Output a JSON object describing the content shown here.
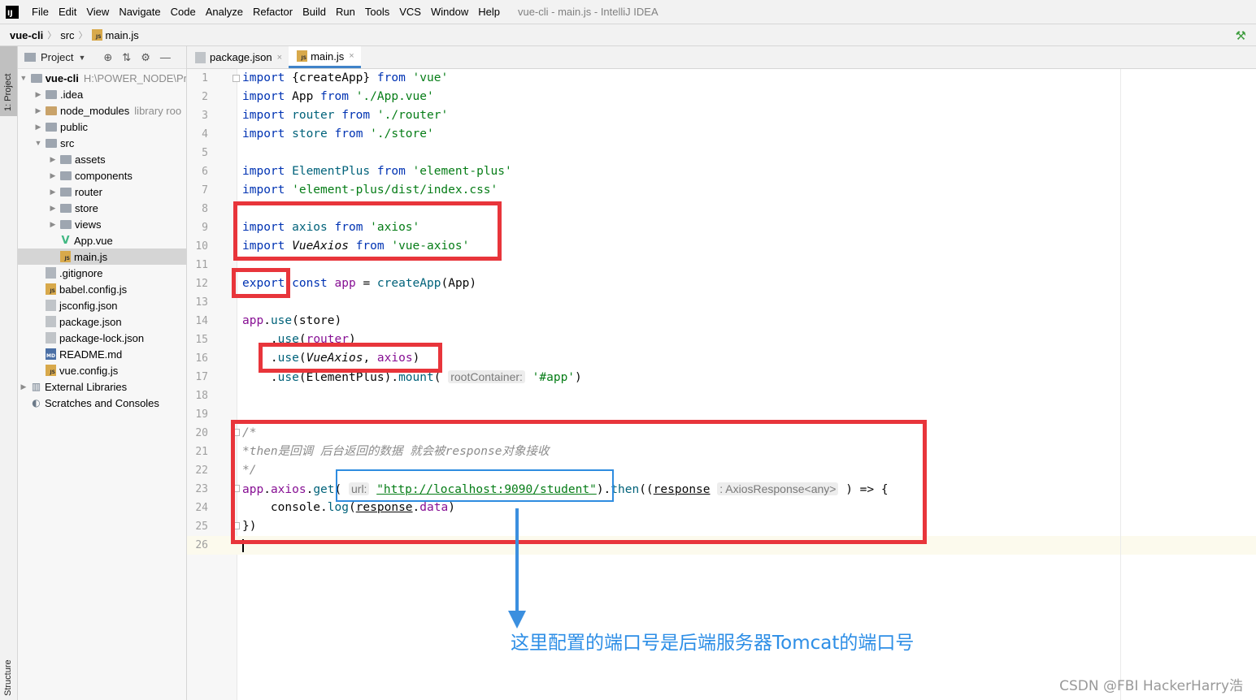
{
  "menubar": {
    "logo": "IJ",
    "items": [
      "File",
      "Edit",
      "View",
      "Navigate",
      "Code",
      "Analyze",
      "Refactor",
      "Build",
      "Run",
      "Tools",
      "VCS",
      "Window",
      "Help"
    ],
    "window_title": "vue-cli - main.js - IntelliJ IDEA"
  },
  "breadcrumb": {
    "project": "vue-cli",
    "folder": "src",
    "file": "main.js"
  },
  "tool_stripe": {
    "project_tab": "1: Project",
    "structure_tab": "Structure"
  },
  "project_panel": {
    "title": "Project",
    "tree": [
      {
        "label": "vue-cli",
        "extra": "H:\\POWER_NODE\\Pr",
        "depth": 0,
        "arrow": "▼",
        "icon": "folder",
        "bold": true
      },
      {
        "label": ".idea",
        "depth": 1,
        "arrow": "▶",
        "icon": "folder"
      },
      {
        "label": "node_modules",
        "extra": "library roo",
        "depth": 1,
        "arrow": "▶",
        "icon": "folder-orange"
      },
      {
        "label": "public",
        "depth": 1,
        "arrow": "▶",
        "icon": "folder"
      },
      {
        "label": "src",
        "depth": 1,
        "arrow": "▼",
        "icon": "folder"
      },
      {
        "label": "assets",
        "depth": 2,
        "arrow": "▶",
        "icon": "folder"
      },
      {
        "label": "components",
        "depth": 2,
        "arrow": "▶",
        "icon": "folder"
      },
      {
        "label": "router",
        "depth": 2,
        "arrow": "▶",
        "icon": "folder"
      },
      {
        "label": "store",
        "depth": 2,
        "arrow": "▶",
        "icon": "folder"
      },
      {
        "label": "views",
        "depth": 2,
        "arrow": "▶",
        "icon": "folder"
      },
      {
        "label": "App.vue",
        "depth": 2,
        "arrow": "",
        "icon": "vue"
      },
      {
        "label": "main.js",
        "depth": 2,
        "arrow": "",
        "icon": "js",
        "selected": true
      },
      {
        "label": ".gitignore",
        "depth": 1,
        "arrow": "",
        "icon": "git"
      },
      {
        "label": "babel.config.js",
        "depth": 1,
        "arrow": "",
        "icon": "js"
      },
      {
        "label": "jsconfig.json",
        "depth": 1,
        "arrow": "",
        "icon": "json"
      },
      {
        "label": "package.json",
        "depth": 1,
        "arrow": "",
        "icon": "json"
      },
      {
        "label": "package-lock.json",
        "depth": 1,
        "arrow": "",
        "icon": "json"
      },
      {
        "label": "README.md",
        "depth": 1,
        "arrow": "",
        "icon": "md"
      },
      {
        "label": "vue.config.js",
        "depth": 1,
        "arrow": "",
        "icon": "js"
      },
      {
        "label": "External Libraries",
        "depth": 0,
        "arrow": "▶",
        "icon": "lib"
      },
      {
        "label": "Scratches and Consoles",
        "depth": 0,
        "arrow": "",
        "icon": "scr"
      }
    ]
  },
  "editor": {
    "tabs": [
      {
        "label": "package.json",
        "active": false
      },
      {
        "label": "main.js",
        "active": true
      }
    ],
    "line_numbers": [
      "1",
      "2",
      "3",
      "4",
      "5",
      "6",
      "7",
      "8",
      "9",
      "10",
      "11",
      "12",
      "13",
      "14",
      "15",
      "16",
      "17",
      "18",
      "19",
      "20",
      "21",
      "22",
      "23",
      "24",
      "25",
      "26"
    ],
    "lines": [
      [
        {
          "t": "import ",
          "c": "kw"
        },
        {
          "t": "{createApp} "
        },
        {
          "t": "from ",
          "c": "kw"
        },
        {
          "t": "'vue'",
          "c": "str"
        }
      ],
      [
        {
          "t": "import ",
          "c": "kw"
        },
        {
          "t": "App "
        },
        {
          "t": "from ",
          "c": "kw"
        },
        {
          "t": "'./App.vue'",
          "c": "str"
        }
      ],
      [
        {
          "t": "import ",
          "c": "kw"
        },
        {
          "t": "router ",
          "c": "fn"
        },
        {
          "t": "from ",
          "c": "kw"
        },
        {
          "t": "'./router'",
          "c": "str"
        }
      ],
      [
        {
          "t": "import ",
          "c": "kw"
        },
        {
          "t": "store ",
          "c": "fn"
        },
        {
          "t": "from ",
          "c": "kw"
        },
        {
          "t": "'./store'",
          "c": "str"
        }
      ],
      [],
      [
        {
          "t": "import ",
          "c": "kw"
        },
        {
          "t": "ElementPlus ",
          "c": "fn"
        },
        {
          "t": "from ",
          "c": "kw"
        },
        {
          "t": "'element-plus'",
          "c": "str"
        }
      ],
      [
        {
          "t": "import ",
          "c": "kw"
        },
        {
          "t": "'element-plus/dist/index.css'",
          "c": "str"
        }
      ],
      [],
      [
        {
          "t": "import ",
          "c": "kw"
        },
        {
          "t": "axios",
          "c": "fn"
        },
        {
          "t": " "
        },
        {
          "t": "from ",
          "c": "kw"
        },
        {
          "t": "'axios'",
          "c": "str"
        }
      ],
      [
        {
          "t": "import ",
          "c": "kw"
        },
        {
          "t": "VueAxios",
          "c": "it"
        },
        {
          "t": " "
        },
        {
          "t": "from ",
          "c": "kw"
        },
        {
          "t": "'vue-axios'",
          "c": "str"
        }
      ],
      [],
      [
        {
          "t": "export",
          "c": "kw"
        },
        {
          "t": " "
        },
        {
          "t": "const ",
          "c": "kw"
        },
        {
          "t": "app ",
          "c": "var"
        },
        {
          "t": "= "
        },
        {
          "t": "createApp",
          "c": "fn"
        },
        {
          "t": "(App)"
        }
      ],
      [],
      [
        {
          "t": "app",
          "c": "var"
        },
        {
          "t": "."
        },
        {
          "t": "use",
          "c": "fn"
        },
        {
          "t": "(store)"
        }
      ],
      [
        {
          "t": "    ."
        },
        {
          "t": "use",
          "c": "fn"
        },
        {
          "t": "("
        },
        {
          "t": "router",
          "c": "var"
        },
        {
          "t": ")"
        }
      ],
      [
        {
          "t": "    ."
        },
        {
          "t": "use",
          "c": "fn"
        },
        {
          "t": "("
        },
        {
          "t": "VueAxios",
          "c": "it"
        },
        {
          "t": ", "
        },
        {
          "t": "axios",
          "c": "var"
        },
        {
          "t": ")"
        }
      ],
      [
        {
          "t": "    ."
        },
        {
          "t": "use",
          "c": "fn"
        },
        {
          "t": "(ElementPlus)."
        },
        {
          "t": "mount",
          "c": "fn"
        },
        {
          "t": "( "
        },
        {
          "t": "rootContainer:",
          "c": "hint"
        },
        {
          "t": " "
        },
        {
          "t": "'#app'",
          "c": "str"
        },
        {
          "t": ")"
        }
      ],
      [],
      [],
      [
        {
          "t": "/*",
          "c": "cmt"
        }
      ],
      [
        {
          "t": "*then是回调 后台返回的数据 就会被response对象接收",
          "c": "cmt"
        }
      ],
      [
        {
          "t": "*/",
          "c": "cmt"
        }
      ],
      [
        {
          "t": "app",
          "c": "var"
        },
        {
          "t": "."
        },
        {
          "t": "axios",
          "c": "var"
        },
        {
          "t": "."
        },
        {
          "t": "get",
          "c": "fn"
        },
        {
          "t": "( "
        },
        {
          "t": "url:",
          "c": "hint"
        },
        {
          "t": " "
        },
        {
          "t": "\"http://localhost:9090/student\"",
          "c": "str ul"
        },
        {
          "t": ")."
        },
        {
          "t": "then",
          "c": "fn"
        },
        {
          "t": "(("
        },
        {
          "t": "response",
          "c": "ul"
        },
        {
          "t": " "
        },
        {
          "t": ": AxiosResponse<any>",
          "c": "hint"
        },
        {
          "t": " ) => {"
        }
      ],
      [
        {
          "t": "    console."
        },
        {
          "t": "log",
          "c": "fn"
        },
        {
          "t": "("
        },
        {
          "t": "response",
          "c": "ul"
        },
        {
          "t": "."
        },
        {
          "t": "data",
          "c": "var"
        },
        {
          "t": ")"
        }
      ],
      [
        {
          "t": "})"
        }
      ],
      []
    ]
  },
  "annotation": {
    "text": "这里配置的端口号是后端服务器Tomcat的端口号",
    "highlight_color": "#e8353b",
    "arrow_color": "#3b8fdf"
  },
  "watermark": "CSDN @FBI HackerHarry浩"
}
